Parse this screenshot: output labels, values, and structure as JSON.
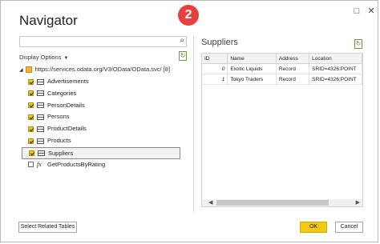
{
  "dialog": {
    "title": "Navigator",
    "step_badge": "2",
    "minimize_glyph": "□",
    "close_glyph": "✕"
  },
  "left_panel": {
    "search_placeholder": "",
    "display_options_label": "Display Options",
    "root": "https://services.odata.org/V3/OData/OData.svc/ [8]",
    "items": [
      {
        "label": "Advertisements",
        "checked": true,
        "kind": "table"
      },
      {
        "label": "Categories",
        "checked": true,
        "kind": "table"
      },
      {
        "label": "PersonDetails",
        "checked": true,
        "kind": "table"
      },
      {
        "label": "Persons",
        "checked": true,
        "kind": "table"
      },
      {
        "label": "ProductDetails",
        "checked": true,
        "kind": "table"
      },
      {
        "label": "Products",
        "checked": true,
        "kind": "table"
      },
      {
        "label": "Suppliers",
        "checked": true,
        "kind": "table",
        "selected": true
      },
      {
        "label": "GetProductsByRating",
        "checked": false,
        "kind": "function"
      }
    ]
  },
  "preview": {
    "title": "Suppliers",
    "columns": [
      "ID",
      "Name",
      "Address",
      "Location"
    ],
    "rows": [
      [
        "0",
        "Exotic Liquids",
        "Record",
        "SRID=4326;POINT"
      ],
      [
        "1",
        "Tokyo Traders",
        "Record",
        "SRID=4326;POINT"
      ]
    ]
  },
  "footer": {
    "select_related_label": "Select Related Tables",
    "ok_label": "OK",
    "cancel_label": "Cancel"
  },
  "colors": {
    "accent": "#f2c811",
    "badge": "#e8403f"
  }
}
